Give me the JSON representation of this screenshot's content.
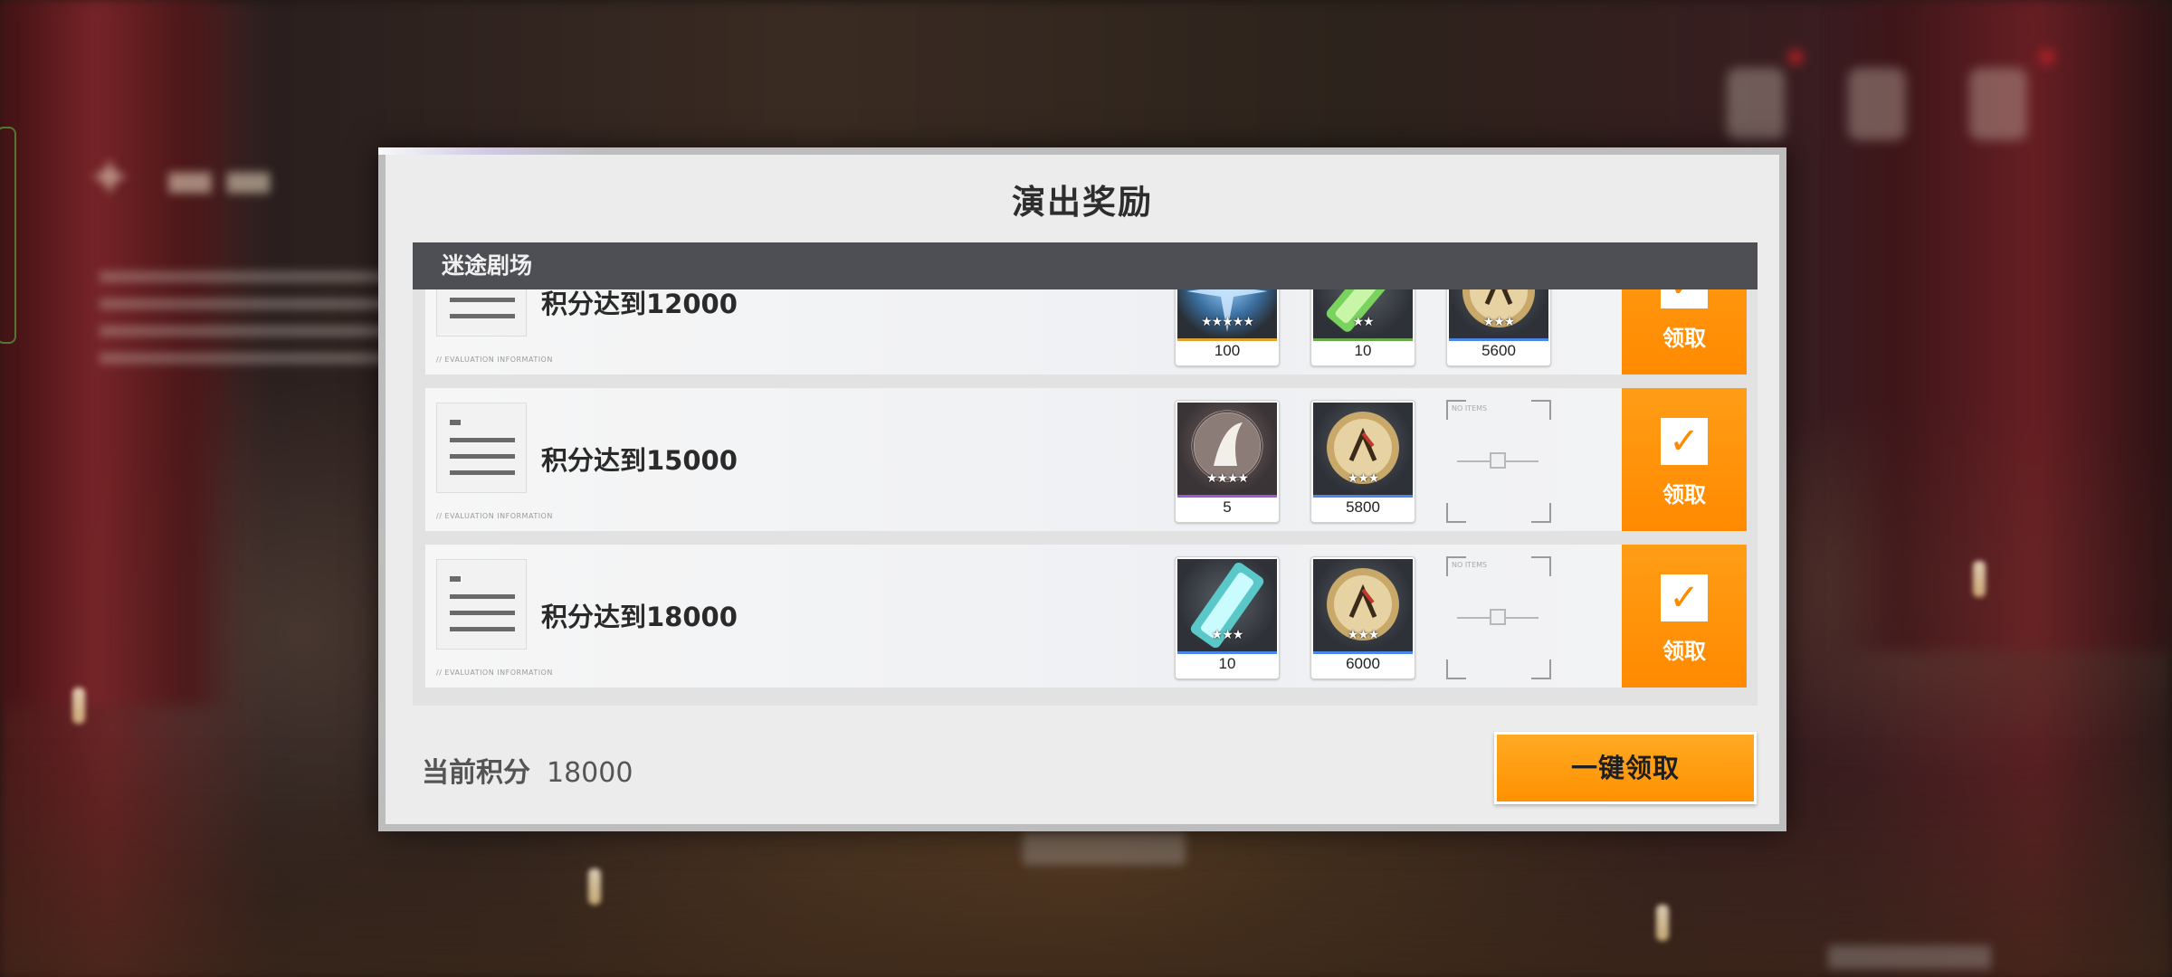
{
  "dialog": {
    "title": "演出奖励",
    "section": "迷途剧场",
    "eval_info_text": "// EVALUATION INFORMATION",
    "empty_slot_text": "NO ITEMS",
    "rows": [
      {
        "label": "积分达到12000",
        "claim_label": "领取",
        "rewards": [
          {
            "name": "blue-crystal-item",
            "stars": 5,
            "stars_text": "★★★★★",
            "qty": "100",
            "rarity_color": "#e0a030"
          },
          {
            "name": "green-canister-item",
            "stars": 2,
            "stars_text": "★★",
            "qty": "10",
            "rarity_color": "#6aa84f"
          },
          {
            "name": "gold-coin-item",
            "stars": 3,
            "stars_text": "★★★",
            "qty": "5600",
            "rarity_color": "#4a86e8"
          }
        ]
      },
      {
        "label": "积分达到15000",
        "claim_label": "领取",
        "rewards": [
          {
            "name": "character-token-item",
            "stars": 4,
            "stars_text": "★★★★",
            "qty": "5",
            "rarity_color": "#9b59d0"
          },
          {
            "name": "gold-coin-item",
            "stars": 3,
            "stars_text": "★★★",
            "qty": "5800",
            "rarity_color": "#4a86e8"
          }
        ]
      },
      {
        "label": "积分达到18000",
        "claim_label": "领取",
        "rewards": [
          {
            "name": "cyan-canister-item",
            "stars": 3,
            "stars_text": "★★★",
            "qty": "10",
            "rarity_color": "#4a86e8"
          },
          {
            "name": "gold-coin-item",
            "stars": 3,
            "stars_text": "★★★",
            "qty": "6000",
            "rarity_color": "#4a86e8"
          }
        ]
      }
    ],
    "score_label": "当前积分",
    "score_value": "18000",
    "claim_all_label": "一键领取"
  },
  "colors": {
    "accent_orange": "#ff8a00",
    "header_gray": "#4d4f55",
    "panel_bg": "#ececec"
  }
}
